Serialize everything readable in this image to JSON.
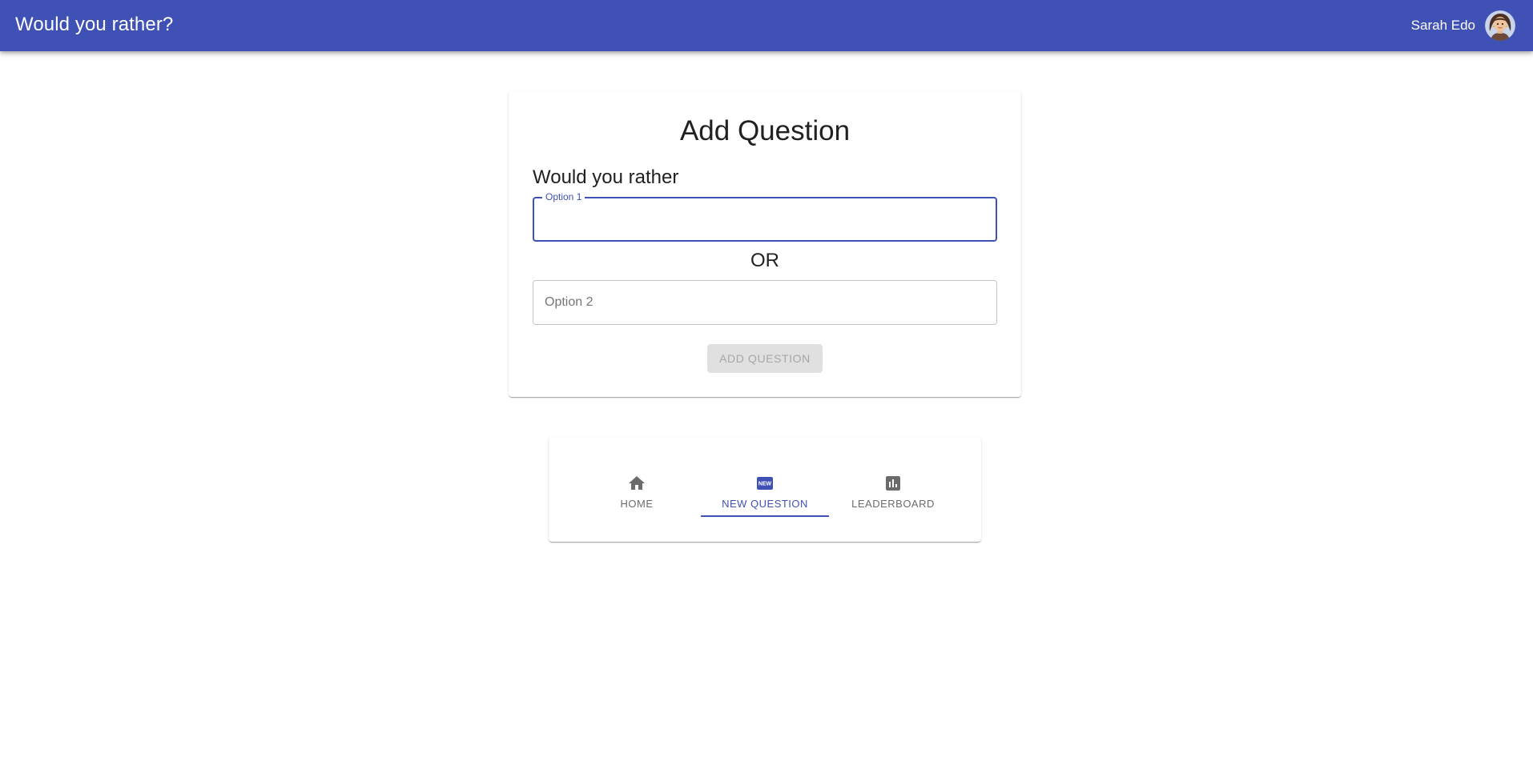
{
  "header": {
    "title": "Would you rather?",
    "user_name": "Sarah Edo",
    "avatar_icon": "user-avatar-icon",
    "color": "#3f51b5"
  },
  "form": {
    "title": "Add Question",
    "prompt": "Would you rather",
    "option1": {
      "label": "Option 1",
      "value": ""
    },
    "separator": "OR",
    "option2": {
      "placeholder": "Option 2",
      "value": ""
    },
    "submit_label": "ADD QUESTION",
    "submit_disabled": true
  },
  "nav": {
    "tabs": [
      {
        "label": "HOME",
        "icon": "home-icon",
        "selected": false
      },
      {
        "label": "NEW QUESTION",
        "icon": "new-badge-icon",
        "selected": true
      },
      {
        "label": "LEADERBOARD",
        "icon": "leaderboard-icon",
        "selected": false
      }
    ],
    "accent": "#3f51b5"
  }
}
